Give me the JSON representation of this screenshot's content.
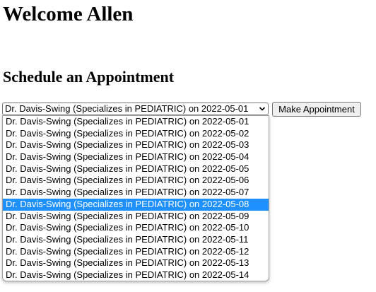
{
  "header": {
    "welcome": "Welcome Allen"
  },
  "schedule": {
    "title": "Schedule an Appointment",
    "selected_value": "Dr. Davis-Swing (Specializes in PEDIATRIC) on 2022-05-01",
    "button_label": "Make Appointment",
    "highlighted_index": 7,
    "options": [
      "Dr. Davis-Swing (Specializes in PEDIATRIC) on 2022-05-01",
      "Dr. Davis-Swing (Specializes in PEDIATRIC) on 2022-05-02",
      "Dr. Davis-Swing (Specializes in PEDIATRIC) on 2022-05-03",
      "Dr. Davis-Swing (Specializes in PEDIATRIC) on 2022-05-04",
      "Dr. Davis-Swing (Specializes in PEDIATRIC) on 2022-05-05",
      "Dr. Davis-Swing (Specializes in PEDIATRIC) on 2022-05-06",
      "Dr. Davis-Swing (Specializes in PEDIATRIC) on 2022-05-07",
      "Dr. Davis-Swing (Specializes in PEDIATRIC) on 2022-05-08",
      "Dr. Davis-Swing (Specializes in PEDIATRIC) on 2022-05-09",
      "Dr. Davis-Swing (Specializes in PEDIATRIC) on 2022-05-10",
      "Dr. Davis-Swing (Specializes in PEDIATRIC) on 2022-05-11",
      "Dr. Davis-Swing (Specializes in PEDIATRIC) on 2022-05-12",
      "Dr. Davis-Swing (Specializes in PEDIATRIC) on 2022-05-13",
      "Dr. Davis-Swing (Specializes in PEDIATRIC) on 2022-05-14"
    ]
  },
  "colors": {
    "highlight": "#1e90ff",
    "button_bg": "#efefef"
  },
  "icons": {
    "select_arrow": "chevron-down-icon"
  }
}
